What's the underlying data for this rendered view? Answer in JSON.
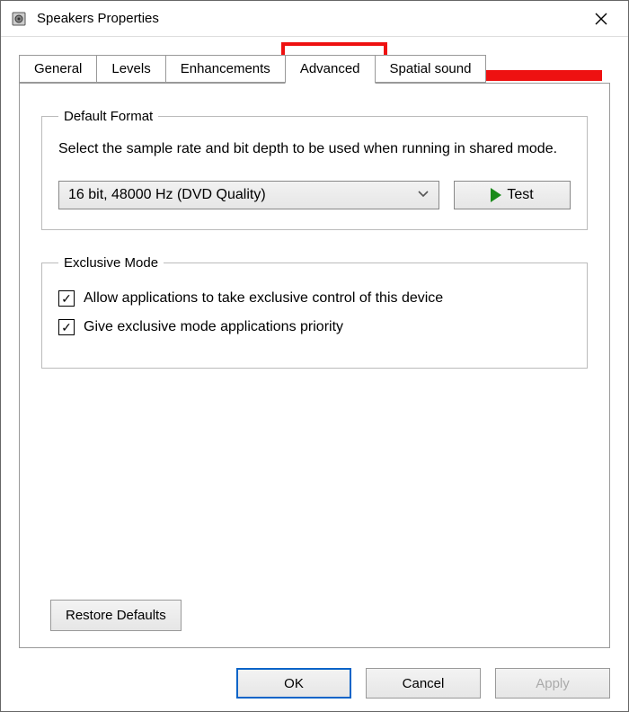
{
  "window": {
    "title": "Speakers Properties"
  },
  "tabs": {
    "items": [
      "General",
      "Levels",
      "Enhancements",
      "Advanced",
      "Spatial sound"
    ],
    "active_index": 3
  },
  "default_format": {
    "legend": "Default Format",
    "description": "Select the sample rate and bit depth to be used when running in shared mode.",
    "selected": "16 bit, 48000 Hz (DVD Quality)",
    "test_label": "Test"
  },
  "exclusive_mode": {
    "legend": "Exclusive Mode",
    "opt1": {
      "label": "Allow applications to take exclusive control of this device",
      "checked": true
    },
    "opt2": {
      "label": "Give exclusive mode applications priority",
      "checked": true
    }
  },
  "restore_label": "Restore Defaults",
  "footer": {
    "ok": "OK",
    "cancel": "Cancel",
    "apply": "Apply"
  },
  "annotation": {
    "color": "#e11",
    "arrows": [
      {
        "type": "right",
        "target": "tab-advanced"
      },
      {
        "type": "up",
        "target": "exclusive-mode-checkboxes"
      }
    ],
    "boxes": [
      "tab-advanced",
      "default-format-group"
    ]
  }
}
